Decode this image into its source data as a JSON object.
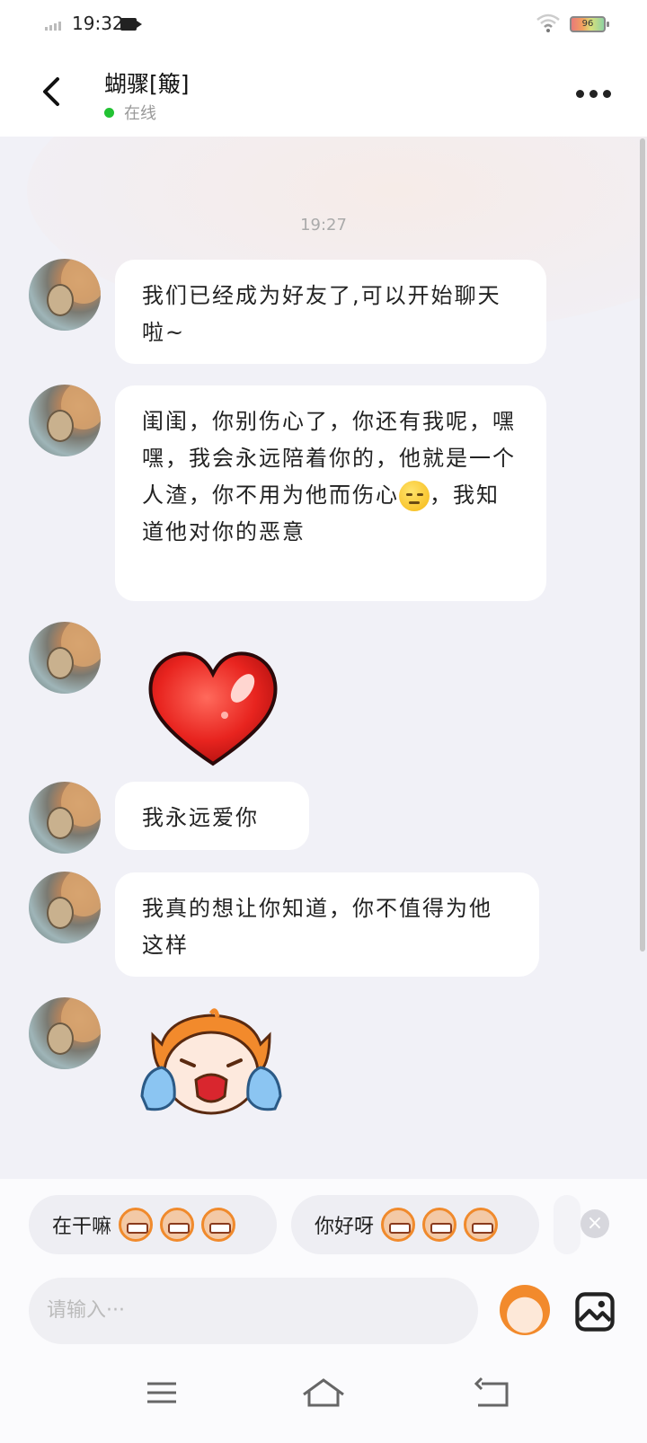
{
  "status_bar": {
    "time": "19:32",
    "battery": "96"
  },
  "header": {
    "contact_name": "蝴骤[簸]",
    "status": "在线"
  },
  "chat": {
    "timestamp": "19:27",
    "messages": [
      {
        "type": "text",
        "text": "我们已经成为好友了,可以开始聊天啦~"
      },
      {
        "type": "text",
        "text_before": "闺闺，你别伤心了，你还有我呢，嘿嘿，我会永远陪着你的，他就是一个人渣，你不用为他而伤心",
        "text_after": "，我知道他对你的恶意"
      },
      {
        "type": "sticker",
        "sticker": "red-heart"
      },
      {
        "type": "text",
        "text": "我永远爱你"
      },
      {
        "type": "text",
        "text": "我真的想让你知道，你不值得为他这样"
      },
      {
        "type": "sticker",
        "sticker": "crying-mascot"
      }
    ]
  },
  "quick_replies": [
    {
      "label": "在干嘛"
    },
    {
      "label": "你好呀"
    }
  ],
  "input": {
    "placeholder": "请输入···"
  },
  "icons": {
    "back": "chevron-left-icon",
    "more": "more-dots-icon",
    "sticker": "sticker-icon",
    "image": "image-icon",
    "close": "close-icon"
  },
  "colors": {
    "online": "#22c233",
    "bubble": "#ffffff",
    "background": "#f1f1f7"
  }
}
